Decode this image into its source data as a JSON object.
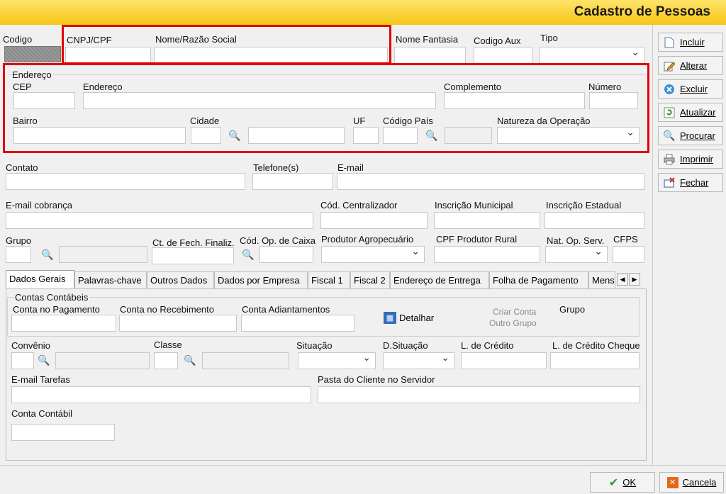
{
  "title": "Cadastro de Pessoas",
  "top": {
    "codigo": "Codigo",
    "cnpj": "CNPJ/CPF",
    "nome": "Nome/Razão Social",
    "fantasia": "Nome Fantasia",
    "codigo_aux": "Codigo Aux",
    "tipo": "Tipo"
  },
  "address": {
    "group": "Endereço",
    "cep": "CEP",
    "endereco": "Endereço",
    "complemento": "Complemento",
    "numero": "Número",
    "bairro": "Bairro",
    "cidade": "Cidade",
    "uf": "UF",
    "codigo_pais": "Código País",
    "natureza": "Natureza da Operação"
  },
  "contact": {
    "contato": "Contato",
    "telefone": "Telefone(s)",
    "email": "E-mail",
    "email_cobranca": "E-mail cobrança",
    "cod_centralizador": "Cód. Centralizador",
    "insc_municipal": "Inscrição Municipal",
    "insc_estadual": "Inscrição Estadual",
    "grupo": "Grupo",
    "ct_fech": "Ct. de Fech. Finaliz.",
    "cod_op_caixa": "Cód. Op. de Caixa",
    "produtor": "Produtor Agropecuário",
    "cpf_produtor": "CPF Produtor Rural",
    "nat_op_serv": "Nat. Op. Serv.",
    "cfps": "CFPS"
  },
  "tabs": [
    {
      "label": "Dados Gerais"
    },
    {
      "label": "Palavras-chave"
    },
    {
      "label": "Outros Dados"
    },
    {
      "label": "Dados por Empresa"
    },
    {
      "label": "Fiscal 1"
    },
    {
      "label": "Fiscal 2"
    },
    {
      "label": "Endereço de Entrega"
    },
    {
      "label": "Folha de Pagamento"
    },
    {
      "label": "Mens"
    }
  ],
  "panel": {
    "contas_group": "Contas Contábeis",
    "conta_pagamento": "Conta no Pagamento",
    "conta_recebimento": "Conta no Recebimento",
    "conta_adiantamentos": "Conta Adiantamentos",
    "detalhar": "Detalhar",
    "criar_conta_1": "Criar Conta",
    "criar_conta_2": "Outro Grupo",
    "grupo": "Grupo",
    "convenio": "Convênio",
    "classe": "Classe",
    "situacao": "Situação",
    "d_situacao": "D.Situação",
    "l_credito": "L. de Crédito",
    "l_credito_cheque": "L. de Crédito Cheque",
    "email_tarefas": "E-mail Tarefas",
    "pasta_cliente": "Pasta do Cliente no Servidor",
    "conta_contabil": "Conta Contábil"
  },
  "side": {
    "incluir": "Incluir",
    "alterar": "Alterar",
    "excluir": "Excluir",
    "atualizar": "Atualizar",
    "procurar": "Procurar",
    "imprimir": "Imprimir",
    "fechar": "Fechar"
  },
  "bottom": {
    "ok": "OK",
    "cancela": "Cancela"
  },
  "colors": {
    "header": "#f6c615",
    "highlight": "#e00000",
    "binoculars": "#1e4aa3"
  }
}
